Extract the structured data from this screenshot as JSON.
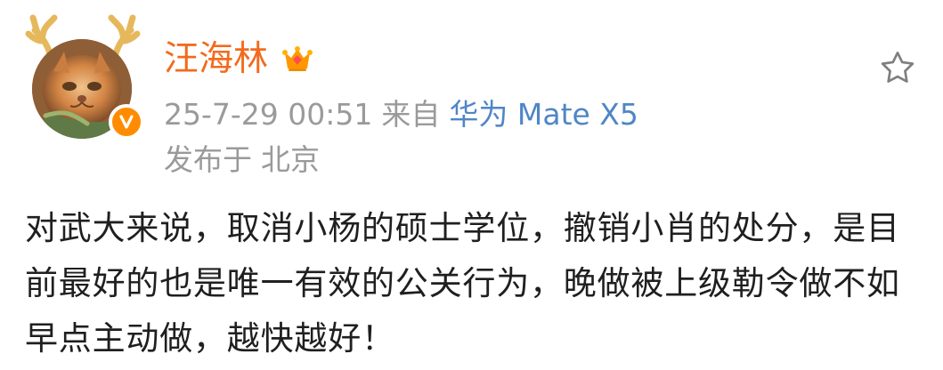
{
  "post": {
    "author": {
      "name": "汪海林",
      "avatar_icon": "cat-avatar",
      "verified_icon": "verified-v-icon",
      "membership_icon": "crown-icon"
    },
    "meta": {
      "time": "25-7-29 00:51",
      "from_label": "来自",
      "device": "华为 Mate X5",
      "location_label": "发布于",
      "location": "北京"
    },
    "actions": {
      "favorite_icon": "star-icon"
    },
    "content": "对武大来说，取消小杨的硕士学位，撤销小肖的处分，是目前最好的也是唯一有效的公关行为，晚做被上级勒令做不如早点主动做，越快越好！"
  },
  "colors": {
    "username": "#f26b1d",
    "device_link": "#4f86c6",
    "meta_text": "#9a9a9a",
    "body_text": "#1f1f1f",
    "verified_badge": "#ff8c00",
    "crown": "#ff9800"
  }
}
